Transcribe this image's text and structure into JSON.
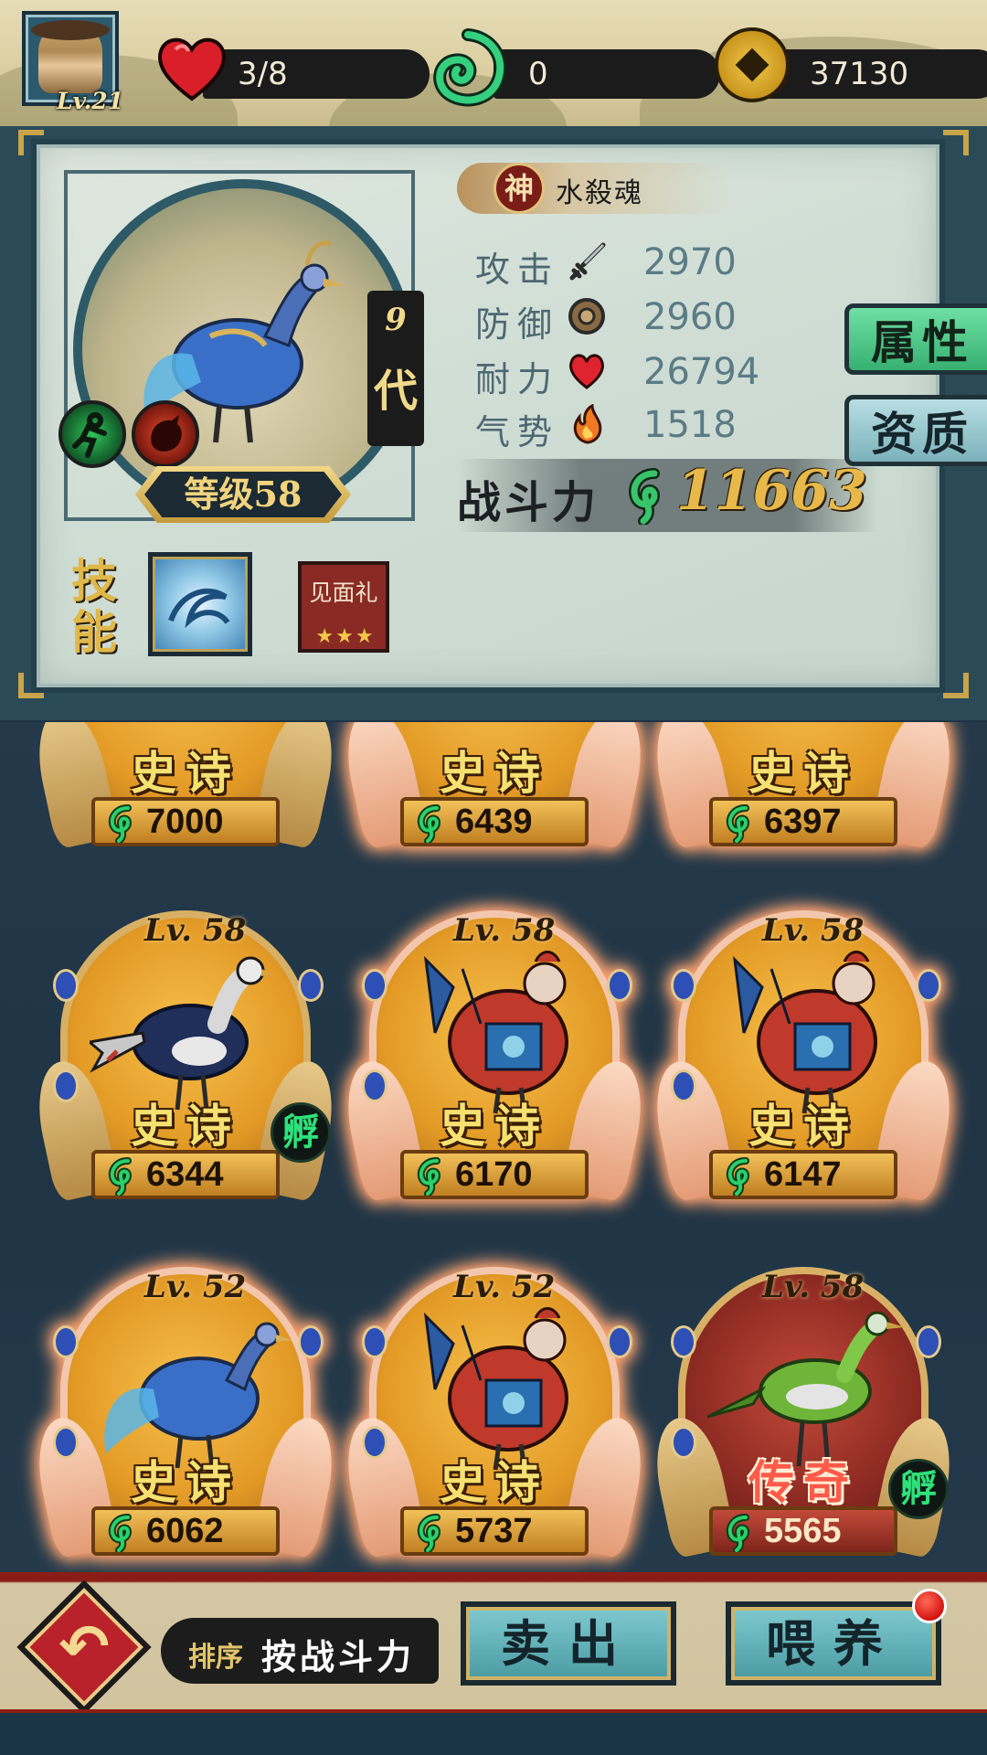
{
  "player": {
    "level": "Lv.21"
  },
  "resources": {
    "hp": "3/8",
    "spirit": "0",
    "coins": "37130"
  },
  "pet_detail": {
    "rarity_seal": "神",
    "name": "水殺魂",
    "generation": "9",
    "generation_label": "代",
    "level_text": "等级58",
    "stats": [
      {
        "label": "攻击",
        "icon": "sword-icon",
        "value": "2970"
      },
      {
        "label": "防御",
        "icon": "shield-icon",
        "value": "2960"
      },
      {
        "label": "耐力",
        "icon": "heart-icon",
        "value": "26794"
      },
      {
        "label": "气势",
        "icon": "flame-icon",
        "value": "1518"
      }
    ],
    "power_label": "战斗力",
    "power_value": "11663",
    "skill_label": "技能",
    "gift_text": "见面礼",
    "gift_stars": "★★★"
  },
  "side_tabs": {
    "attributes": "属性",
    "aptitude": "资质"
  },
  "cards_partial": [
    {
      "rarity": "史诗",
      "power": "7000",
      "glow": false
    },
    {
      "rarity": "史诗",
      "power": "6439",
      "glow": true
    },
    {
      "rarity": "史诗",
      "power": "6397",
      "glow": true
    }
  ],
  "cards": [
    {
      "level": "Lv. 58",
      "rarity": "史诗",
      "power": "6344",
      "bird": "pheasant",
      "glow": false,
      "hatch": "孵",
      "legend": false
    },
    {
      "level": "Lv. 58",
      "rarity": "史诗",
      "power": "6170",
      "bird": "opera-rooster",
      "glow": true,
      "hatch": "",
      "legend": false
    },
    {
      "level": "Lv. 58",
      "rarity": "史诗",
      "power": "6147",
      "bird": "opera-rooster",
      "glow": true,
      "hatch": "",
      "legend": false
    },
    {
      "level": "Lv. 52",
      "rarity": "史诗",
      "power": "6062",
      "bird": "blue-phoenix",
      "glow": true,
      "hatch": "",
      "legend": false
    },
    {
      "level": "Lv. 52",
      "rarity": "史诗",
      "power": "5737",
      "bird": "opera-rooster",
      "glow": true,
      "hatch": "",
      "legend": false
    },
    {
      "level": "Lv. 58",
      "rarity": "传奇",
      "power": "5565",
      "bird": "green-bird",
      "glow": false,
      "hatch": "孵",
      "legend": true
    }
  ],
  "bottom": {
    "sort_label": "排序",
    "sort_value": "按战斗力",
    "sell_label": "卖出",
    "feed_label": "喂养"
  },
  "colors": {
    "accent_gold": "#e8b94a",
    "legend_red": "#ff5a4a",
    "epic_yellow": "#f6e070"
  }
}
